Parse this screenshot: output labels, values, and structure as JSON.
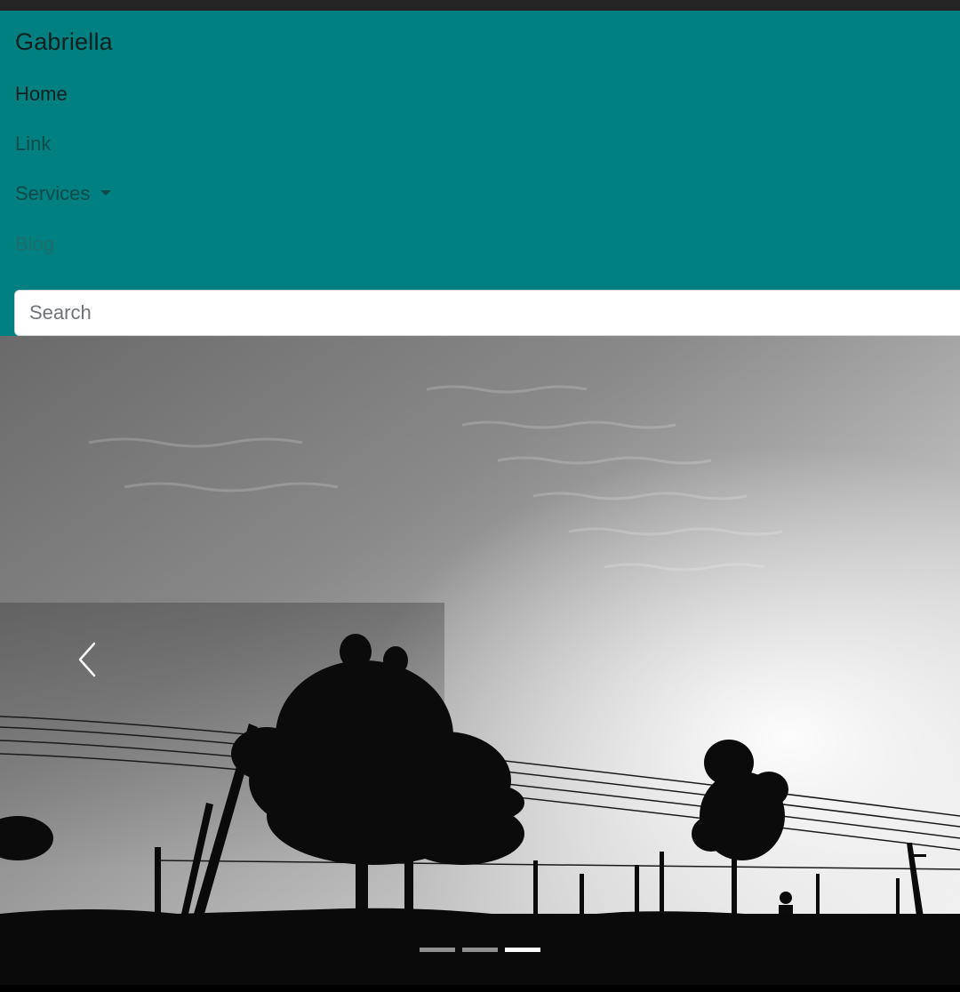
{
  "navbar": {
    "brand": "Gabriella",
    "items": [
      {
        "label": "Home"
      },
      {
        "label": "Link"
      },
      {
        "label": "Services"
      },
      {
        "label": "Blog"
      }
    ],
    "search": {
      "placeholder": "Search",
      "value": ""
    }
  },
  "carousel": {
    "prev_icon": "chevron-left-icon",
    "slide_count": 3,
    "active_slide": 3
  },
  "colors": {
    "navbar_bg": "#008080",
    "search_bg": "#ffffff"
  }
}
